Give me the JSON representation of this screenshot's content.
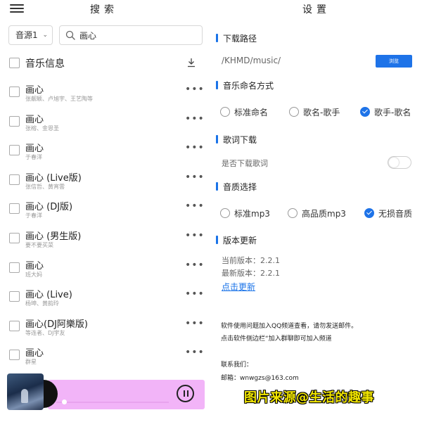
{
  "left": {
    "title": "搜索",
    "source_select": "音源1",
    "search_value": "画心",
    "header_label": "音乐信息",
    "songs": [
      {
        "title": "画心",
        "artist": "张靓颖、卢旭宇、王艺陶等"
      },
      {
        "title": "画心",
        "artist": "张榕、金恩圣"
      },
      {
        "title": "画心",
        "artist": "于春洋"
      },
      {
        "title": "画心 (Live版)",
        "artist": "张信哲、黄宵雲"
      },
      {
        "title": "画心 (DJ版)",
        "artist": "于春洋"
      },
      {
        "title": "画心 (男生版)",
        "artist": "要不要买菜"
      },
      {
        "title": "画心",
        "artist": "班大妈"
      },
      {
        "title": "画心 (Live)",
        "artist": "杨坤、黄韵玲"
      },
      {
        "title": "画心(DJ阿樂版)",
        "artist": "等连者、DJ宇友"
      },
      {
        "title": "画心",
        "artist": "群星"
      }
    ],
    "more_glyph": "•••"
  },
  "right": {
    "title": "设置",
    "download_path": {
      "heading": "下载路径",
      "path": "/KHMD/music/",
      "button": "浏览"
    },
    "naming": {
      "heading": "音乐命名方式",
      "options": [
        "标准命名",
        "歌名-歌手",
        "歌手-歌名"
      ],
      "selected_index": 2
    },
    "lyrics": {
      "heading": "歌词下载",
      "label": "是否下载歌词",
      "enabled": false
    },
    "quality": {
      "heading": "音质选择",
      "options": [
        "标准mp3",
        "高品质mp3",
        "无损音质"
      ],
      "selected_index": 2
    },
    "version": {
      "heading": "版本更新",
      "current": "当前版本：2.2.1",
      "latest": "最新版本：2.2.1",
      "update_link": "点击更新"
    },
    "info": {
      "line1": "软件使用问题加入QQ频道查看，请勿发送邮件。",
      "line2": "点击软件侧边栏“加入群聊即可加入频道",
      "contact": "联系我们：",
      "email": "邮箱：wnwgzs@163.com"
    }
  },
  "watermark": "图片来源@生活的趣事",
  "player": {
    "progress": 0.05,
    "accent": "#f2b4f8"
  },
  "colors": {
    "accent_blue": "#1e73e8",
    "watermark_yellow": "#f2e600"
  }
}
